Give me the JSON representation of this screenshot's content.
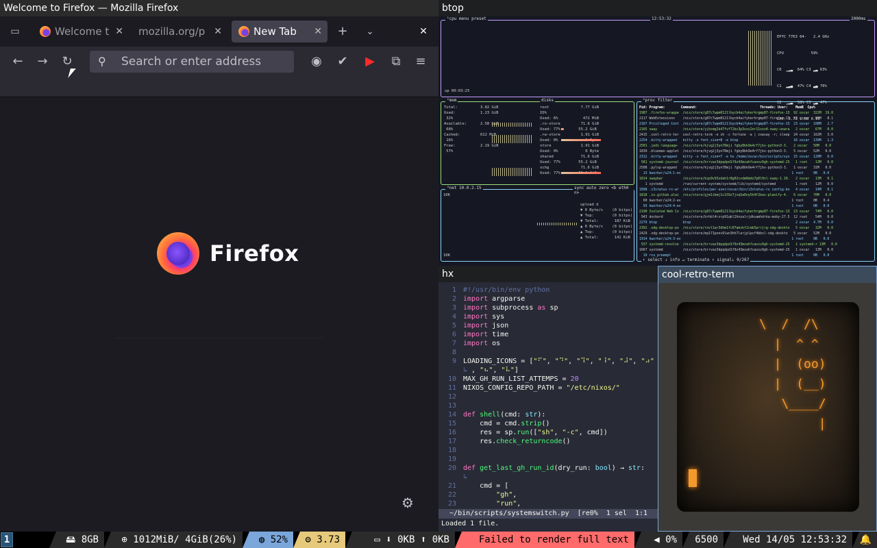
{
  "firefox": {
    "title": "Welcome to Firefox — Mozilla Firefox",
    "tabs": [
      {
        "label": "Welcome t"
      },
      {
        "label": "mozilla.org/p"
      },
      {
        "label": "New Tab"
      }
    ],
    "search_placeholder": "Search or enter address",
    "wordmark": "Firefox"
  },
  "btop": {
    "title": "btop",
    "cpu_label": "¹cpu menu preset",
    "clock": "12:53:32",
    "interval": "2000ms",
    "cpu_name": "EPYC 7763 64-",
    "cpu_freq": "2.4 GHz",
    "cpu_rows": [
      "CPU            59%",
      "C0  ▁▂▃  64% C3 ▂▃ 63%",
      "C1  ▂▃▄  47% C4 ▃▄ 76%",
      "C2  ▁▂▃  58% C5 ▂▃ 47%",
      "LAV: 3.73 1.68 0.65"
    ],
    "uptime": "up 00:03:25",
    "mem_label": "²mem",
    "disks_label": "disks",
    "mem_rows": [
      "Total:          3.82 GiB",
      "Used:           1.23 GiB",
      " 32%",
      "",
      "Available:      2.58 GiB",
      " 68%",
      "",
      "Cached:         612 MiB",
      " 16%",
      "",
      "Free:           2.19 GiB",
      " 57%"
    ],
    "disk_rows": [
      "root              7.77 GiB",
      "IO%",
      "Used: 6%           472 MiB",
      ".ro-store         71.6 GiB",
      "Used: 77%        55.2 GiB",
      ".rw-store         1.91 GiB",
      "Used: 0%            0 Byte",
      "store             1.91 GiB",
      "Used: 0%            0 Byte",
      "shared            71.6 GiB",
      "Used: 77%        55.2 GiB",
      "xchg              71.6 GiB",
      "Used: 77%        55.2 GiB"
    ],
    "net_label": "³net 10.0.2.15",
    "net_iface": "sync auto zero <b eth0 n>",
    "net_top": "10K",
    "net_bottom": "10K",
    "net_rows": [
      "upload d",
      "▼ 0 Byte/s    (0 bitps)",
      "▼ Top:        (0 bitps)",
      "▼ Total:       187 KiB",
      "",
      "▲ 0 Byte/s    (0 bitps)",
      "▲ Top:        (0 bitps)",
      "▲ Total:       141 KiB"
    ],
    "proc_label": "⁴proc filter",
    "proc_header": "Pid: Program:        Command:                                Threads: User:    MemB  Cpu%",
    "proc_rows": [
      "1987 .firefox-wrappe  /nix/store/g87c7wpm0121lbycb4aifykerhrgmp87-firefox-13  92 oscar  322M  19.0",
      "2117 WebExtensions    /nix/store/g87c7wpm0121lbycb4aifykerhrgmp87-firefox-13  23 oscar   99M   8.1",
      "2167 Privileged Cont  /nix/store/g87c7wpm0121lbycb4aifykerhrgmp87-firefox-13  23 oscar  108M   2.7",
      "2165 sway             /nix/store/yjbsmg2k47fvf72bc3p3xxs2nr11sxo4-sway-unwra   2 oscar   67M   0.0",
      "2415 .cool-retro-ter  cool-retro-term -e sh -c fortune -a | cowsay -r; sleep  24 oscar  162M   3.0",
      "2254 .kitty-wrapped   kitty -o font_size=8 -e btop                            16 oscar  139M   1.3",
      "2501 .jedi-language-  /nix/store/kjvg2j3yn78mji fgby8bk9e4rf7jbs-python3-3.   2 oscar   50M   0.0",
      "1839 .blueman-applet  /nix/store/kjvg2j3yn78mji fgby8bk9e4rf7jbs-python3-3.   5 oscar   52M   0.0",
      "2312 .kitty-wrapped   kitty -o font_size=7 -e hx /home/oscar/bin/scripts/sys  15 oscar  120M   0.0",
      " 581 systemd-journal  /nix/store/brrvaz3dpqdpd1f9z43mzahfcaosv9gh-systemd-25   1 root    13M   0.0",
      "2508 .pylsp-wrapped   /nix/store/kjvg2j3yn78mji fgby8bk9e4rf7jbs-python3-3.   1 oscar   31M   0.0",
      "  13 kworker/u24:1-ev                                                        1 root     0B   0.0",
      "1814 swaybar          /nix/store/bzp9v93zdah1r8g02cvdm8mdz7p0l9nl-sway-1.10.   2 oscar   13M   0.1",
      "   1 systemd          /run/current-system/systemd/lib/systemd/systemd          1 root    12M   0.0",
      "1898 .i3status-rs-wr  /etc/profiles/per-user/oscar/bin/i3status-rs config-bo   4 oscar   14M   0.1",
      "1818 .io.github.alai  /nix/store/gjm1ibmj1c159z7jvq5a0ny5h4f2bas-planify-4.   6 oscar   70M   0.0",
      "  60 kworker/u24:2-ev                                                        1 root     0B   0.4",
      "  93 kworker/u24:4-ev                                                        1 root     0B   0.0",
      "2190 Isolated Web Co  /nix/store/g87c7wpm0121lbycb4aifykerhrgmp87-firefox-13  23 oscar   74M   0.0",
      " 943 dockerd          /nix/store/brhbl4rzrp91qkl2hnzalrjdksamhdrka-moby-27.5  12 root    54M   0.0",
      "2279 btop             btop                                                     2 oscar  4.7M   0.0",
      "2392 .xdg-desktop-po  /nix/store/rnvl1ar3dhm1fc07qmvbf2cmk5prrjrg-xdg-deskto   5 oscar   32M   0.0",
      "2429 .xdg-desktop-po  /nix/store/mp171ponv9lwn3hh7larjplpcf4bbxl-xdg-deskto   5 oscar   52M   0.0",
      "1914 kworker/u24:3-ev                                                        1 root     0B   0.0",
      " 557 systemd-resolve  /nix/store/brrvaz3dpqdpd1f9z43mzahfcaosv9gh-systemd-25   1 systemd-r 13M   0.0",
      "1667 systemd          /nix/store/brrvaz3dpqdpd1f9z43mzahfcaosv9gh-systemd-25   1 oscar   13M   0.0",
      "  19 rcu_preempt                                                             1 root     0B   0.0"
    ],
    "proc_footer": "↑ select ↓ info ↵ terminate ↑ signal↓           0/267"
  },
  "hx": {
    "title": "hx",
    "lines": [
      {
        "n": "1",
        "c": [
          [
            "cm",
            "#!/usr/bin/env python"
          ]
        ]
      },
      {
        "n": "2",
        "c": [
          [
            "kw",
            "import"
          ],
          [
            "",
            " argparse"
          ]
        ]
      },
      {
        "n": "3",
        "c": [
          [
            "kw",
            "import"
          ],
          [
            "",
            " subprocess "
          ],
          [
            "kw",
            "as"
          ],
          [
            "",
            " sp"
          ]
        ]
      },
      {
        "n": "4",
        "c": [
          [
            "kw",
            "import"
          ],
          [
            "",
            " sys"
          ]
        ]
      },
      {
        "n": "5",
        "c": [
          [
            "kw",
            "import"
          ],
          [
            "",
            " json"
          ]
        ]
      },
      {
        "n": "6",
        "c": [
          [
            "kw",
            "import"
          ],
          [
            "",
            " time"
          ]
        ]
      },
      {
        "n": "7",
        "c": [
          [
            "kw",
            "import"
          ],
          [
            "",
            " os"
          ]
        ]
      },
      {
        "n": "8",
        "c": []
      },
      {
        "n": "9",
        "c": [
          [
            "",
            "LOADING_ICONS = ["
          ],
          [
            "st",
            "\"⠋\""
          ],
          [
            "",
            ", "
          ],
          [
            "st",
            "\"⠙\""
          ],
          [
            "",
            ", "
          ],
          [
            "st",
            "\"⠹\""
          ],
          [
            "",
            ", "
          ],
          [
            "st",
            "\"⠸\""
          ],
          [
            "",
            ", "
          ],
          [
            "st",
            "\"⠼\""
          ],
          [
            "",
            ", "
          ],
          [
            "st",
            "\"⠴\""
          ]
        ]
      },
      {
        "n": "",
        "c": [
          [
            "cm",
            "↳"
          ],
          [
            "",
            " , "
          ],
          [
            "st",
            "\"⠦\""
          ],
          [
            "",
            ", "
          ],
          [
            "st",
            "\"⠧\""
          ],
          [
            "",
            "]"
          ]
        ]
      },
      {
        "n": "10",
        "c": [
          [
            "",
            "MAX_GH_RUN_LIST_ATTEMPS = "
          ],
          [
            "nu",
            "20"
          ]
        ]
      },
      {
        "n": "11",
        "c": [
          [
            "",
            "NIXOS_CONFIG_REPO_PATH = "
          ],
          [
            "st",
            "\"/etc/nixos/\""
          ]
        ]
      },
      {
        "n": "12",
        "c": []
      },
      {
        "n": "13",
        "c": []
      },
      {
        "n": "14",
        "c": [
          [
            "kw",
            "def"
          ],
          [
            "",
            " "
          ],
          [
            "fn",
            "shell"
          ],
          [
            "",
            "(cmd: "
          ],
          [
            "ty",
            "str"
          ],
          [
            "",
            "):"
          ]
        ]
      },
      {
        "n": "15",
        "c": [
          [
            "",
            "    cmd = cmd."
          ],
          [
            "fn",
            "strip"
          ],
          [
            "",
            "()"
          ]
        ]
      },
      {
        "n": "16",
        "c": [
          [
            "",
            "    res = sp."
          ],
          [
            "fn",
            "run"
          ],
          [
            "",
            "(["
          ],
          [
            "st",
            "\"sh\""
          ],
          [
            "",
            ", "
          ],
          [
            "st",
            "\"-c\""
          ],
          [
            "",
            ", cmd])"
          ]
        ]
      },
      {
        "n": "17",
        "c": [
          [
            "",
            "    res."
          ],
          [
            "fn",
            "check_returncode"
          ],
          [
            "",
            "()"
          ]
        ]
      },
      {
        "n": "18",
        "c": []
      },
      {
        "n": "19",
        "c": []
      },
      {
        "n": "20",
        "c": [
          [
            "kw",
            "def"
          ],
          [
            "",
            " "
          ],
          [
            "fn",
            "get_last_gh_run_id"
          ],
          [
            "",
            "(dry_run: "
          ],
          [
            "ty",
            "bool"
          ],
          [
            "",
            ") → "
          ],
          [
            "ty",
            "str"
          ],
          [
            "",
            ":"
          ]
        ]
      },
      {
        "n": "",
        "c": [
          [
            "cm",
            "↳"
          ]
        ]
      },
      {
        "n": "21",
        "c": [
          [
            "",
            "    cmd = ["
          ]
        ]
      },
      {
        "n": "22",
        "c": [
          [
            "",
            "        "
          ],
          [
            "st",
            "\"gh\""
          ],
          [
            "",
            ","
          ]
        ]
      },
      {
        "n": "23",
        "c": [
          [
            "",
            "        "
          ],
          [
            "st",
            "\"run\""
          ],
          [
            "",
            ","
          ]
        ]
      }
    ],
    "status": "  ~/bin/scripts/systemswitch.py  [re0%  1 sel  1:1",
    "message": "Loaded 1 file."
  },
  "crt": {
    "title": "cool-retro-term",
    "art": "\\  /  /\\\n  |  ^ ^\n  |  (oo)\n  |  (__)\n   \\____/\n        |"
  },
  "swaybar": {
    "workspace": "1",
    "disk": "8GB",
    "memory": "1012MiB/ 4GiB(26%)",
    "cpu": "52%",
    "load": "3.73",
    "net_down": "0KB",
    "net_up": "0KB",
    "error": "Failed to render full text",
    "volume": "0%",
    "brightness": "6500",
    "datetime": "Wed 14/05 12:53:32"
  },
  "colors": {
    "accent": "#7aa6da",
    "btop_cpu": "#c8a0ff",
    "btop_mem": "#9ee07a",
    "btop_net": "#8fd3ff",
    "error": "#ff6b6b"
  }
}
